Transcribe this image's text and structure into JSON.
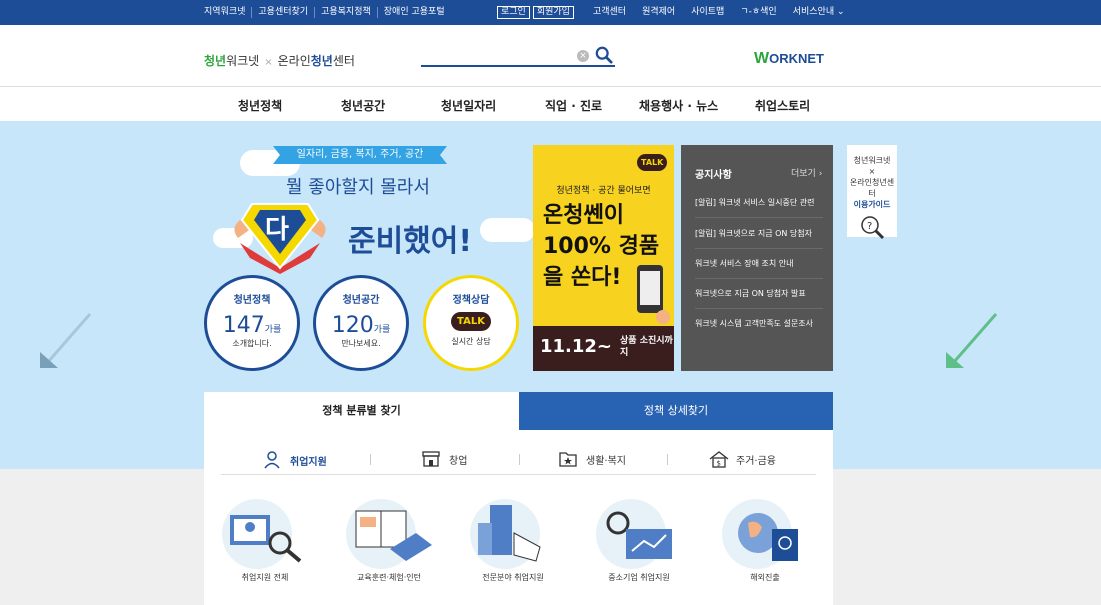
{
  "topbar": {
    "left_links": [
      "지역워크넷",
      "고용센터찾기",
      "고용복지정책",
      "장애인 고용포털"
    ],
    "login": "로그인",
    "join": "회원가입",
    "right_links": [
      "고객센터",
      "원격제어",
      "사이트맵",
      "ㄱ-ㅎ색인",
      "서비스안내"
    ]
  },
  "header": {
    "logo_youth": "청년",
    "logo_worknet": "워크넷",
    "logo_sep": "×",
    "logo_online": "온라인",
    "logo_youth2": "청년",
    "logo_center": "센터",
    "search_placeholder": "",
    "worknet_w": "W",
    "worknet_rest": "ORKNET"
  },
  "gnb": [
    "청년정책",
    "청년공간",
    "청년일자리",
    "직업 · 진로",
    "채용행사 · 뉴스",
    "취업스토리"
  ],
  "hero": {
    "ribbon": "일자리, 금융, 복지, 주거, 공간",
    "headline1": "뭘 좋아할지 몰라서",
    "badge": "다",
    "headline2": "준비했어!",
    "circles": [
      {
        "title": "청년정책",
        "number": "147",
        "unit": "가를",
        "sub": "소개합니다."
      },
      {
        "title": "청년공간",
        "number": "120",
        "unit": "가를",
        "sub": "만나보세요."
      },
      {
        "title": "정책상담",
        "talk": "TALK",
        "sub": "실시간 상담"
      }
    ]
  },
  "banner": {
    "talk": "TALK",
    "sub": "청년정책 · 공간 물어보면",
    "line1": "온청쎈이",
    "line2": "100% 경품",
    "line3": "을 쏜다!",
    "date": "11.12~",
    "prize": "상품 소진시까지"
  },
  "notice": {
    "title": "공지사항",
    "more": "더보기 ›",
    "items": [
      "[알림] 워크넷 서비스 일시중단 관련",
      "[알림] 워크넷으로 지금 ON 당첨자",
      "워크넷 서비스 장애 조치 안내",
      "워크넷으로 지금 ON 당첨자 발표",
      "워크넷 시스템 고객만족도 설문조사"
    ]
  },
  "guide": {
    "line1": "청년워크넷",
    "line2": "×",
    "line3": "온라인청년센터",
    "line4": "이용가이드"
  },
  "finder": {
    "tab_active": "정책 분류별 찾기",
    "tab_other": "정책 상세찾기",
    "categories": [
      "취업지원",
      "창업",
      "생활·복지",
      "주거·금융"
    ],
    "items": [
      "취업지원 전체",
      "교육훈련·체험·인턴",
      "전문분야 취업지원",
      "중소기업 취업지원",
      "해외진출"
    ]
  },
  "colors": {
    "primary": "#1e4d98",
    "green": "#2ba63b",
    "hero_bg": "#c8e6f9",
    "kakao_yellow": "#f7d21e"
  }
}
